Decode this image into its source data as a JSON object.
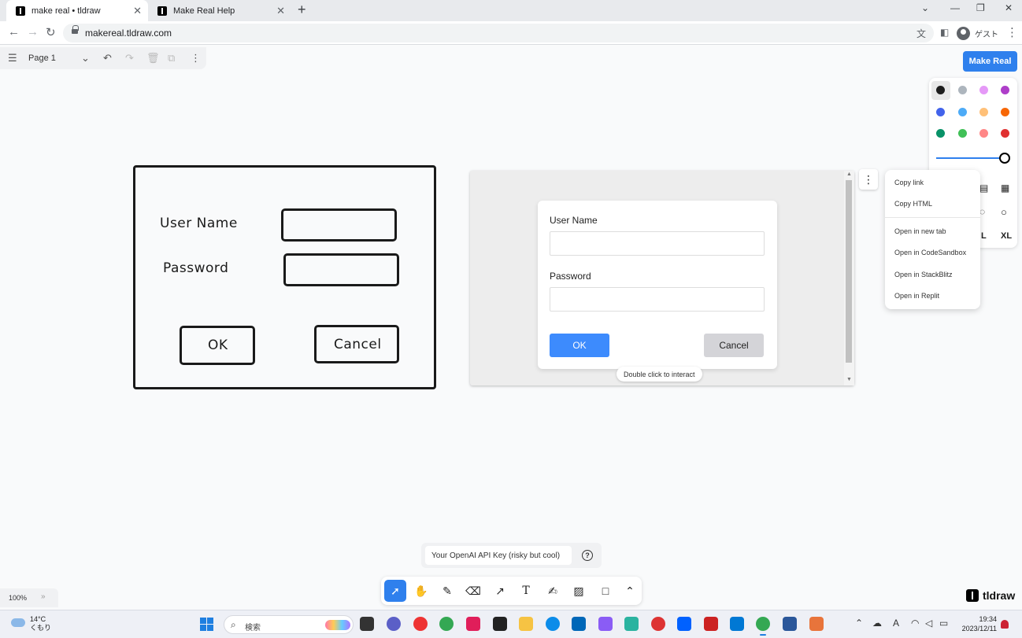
{
  "browser": {
    "tabs": [
      {
        "title": "make real • tldraw",
        "active": true
      },
      {
        "title": "Make Real Help",
        "active": false
      }
    ],
    "url": "makereal.tldraw.com",
    "profile_label": "ゲスト"
  },
  "menubar": {
    "page_label": "Page 1"
  },
  "make_real_label": "Make Real",
  "style_panel": {
    "colors": [
      "#1d1d1d",
      "#adb5bd",
      "#e599f7",
      "#ae3ec9",
      "#4263eb",
      "#4dabf7",
      "#ffc078",
      "#f76707",
      "#099268",
      "#40c057",
      "#ff8787",
      "#e03131"
    ],
    "size_labels": [
      "L",
      "XL"
    ],
    "opacity": 1.0
  },
  "sketch": {
    "username_label": "User Name",
    "password_label": "Password",
    "ok_label": "OK",
    "cancel_label": "Cancel"
  },
  "preview": {
    "username_label": "User Name",
    "password_label": "Password",
    "ok_label": "OK",
    "cancel_label": "Cancel",
    "hint": "Double click to interact"
  },
  "context_menu": {
    "items": [
      "Copy link",
      "Copy HTML",
      "Open in new tab",
      "Open in CodeSandbox",
      "Open in StackBlitz",
      "Open in Replit"
    ]
  },
  "api_key": {
    "placeholder": "Your OpenAI API Key (risky but cool)"
  },
  "zoom_level": "100%",
  "brand": "tldraw",
  "taskbar": {
    "temperature": "14°C",
    "weather": "くもり",
    "search_placeholder": "検索",
    "time": "19:34",
    "date": "2023/12/11"
  }
}
